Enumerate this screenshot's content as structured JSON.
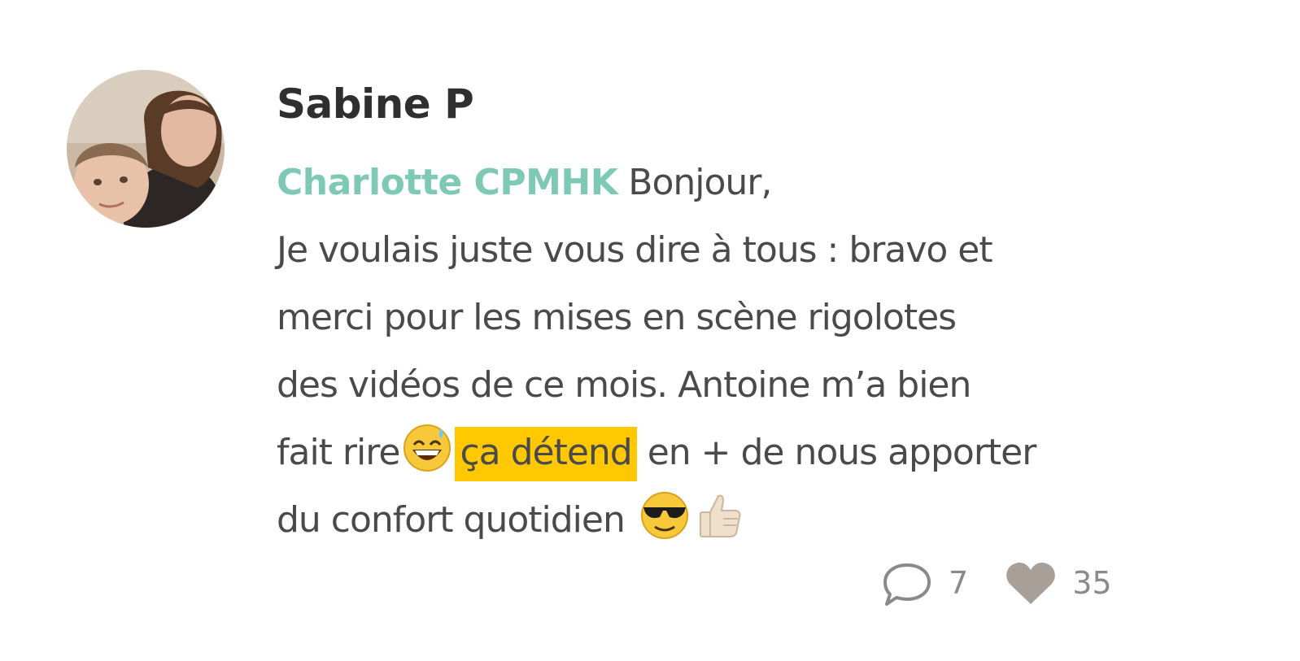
{
  "post": {
    "author_name": "Sabine P",
    "mention": "Charlotte CPMHK",
    "comment_lines": {
      "l1_rest": " Bonjour,",
      "l2": "Je voulais juste vous dire à tous : bravo et",
      "l3": "merci pour les mises en scène rigolotes",
      "l4": "des vidéos de ce mois. Antoine m’a bien",
      "l5_a": "fait rire",
      "l5_highlight": "ça détend",
      "l5_b": " en + de nous apporter",
      "l6": "du confort quotidien"
    },
    "emojis": [
      "grinning-sweat-emoji",
      "sunglasses-emoji",
      "thumbs-up-emoji"
    ],
    "highlight_color": "#ffc800",
    "mention_color": "#7ec9b3"
  },
  "actions": {
    "comment_count": "7",
    "like_count": "35"
  }
}
